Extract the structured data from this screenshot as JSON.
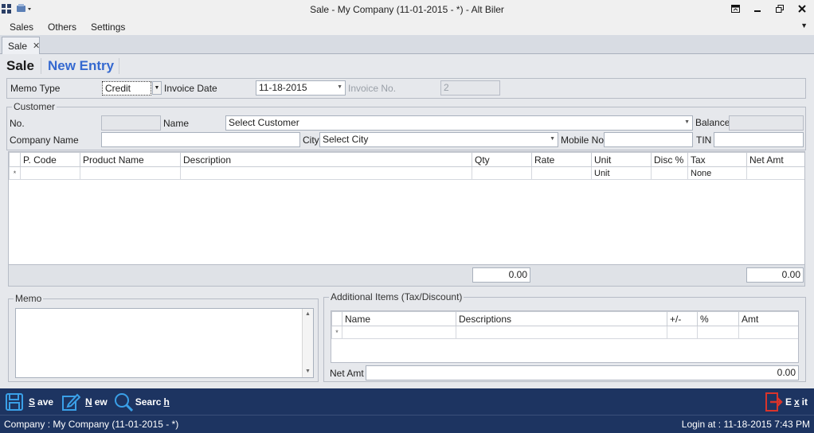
{
  "window": {
    "title": "Sale - My Company (11-01-2015 - *) - Alt Biler"
  },
  "menu": {
    "items": [
      "Sales",
      "Others",
      "Settings"
    ]
  },
  "tab": {
    "label": "Sale"
  },
  "heading": {
    "title": "Sale",
    "mode": "New Entry"
  },
  "memo_type": {
    "label": "Memo Type",
    "value": "Credit"
  },
  "invoice_date": {
    "label": "Invoice Date",
    "value": "11-18-2015"
  },
  "invoice_no": {
    "label": "Invoice No.",
    "value": "2"
  },
  "customer": {
    "legend": "Customer",
    "no_label": "No.",
    "no_value": "",
    "name_label": "Name",
    "name_value": "Select Customer",
    "balance_label": "Balance",
    "balance_value": "",
    "company_label": "Company Name",
    "company_value": "",
    "city_label": "City",
    "city_value": "Select City",
    "mobile_label": "Mobile No.",
    "mobile_value": "",
    "tin_label": "TIN",
    "tin_value": ""
  },
  "product_grid": {
    "columns": [
      "P. Code",
      "Product Name",
      "Description",
      "Qty",
      "Rate",
      "Unit",
      "Disc %",
      "Tax",
      "Net Amt"
    ],
    "new_row": {
      "marker": "*",
      "unit": "Unit",
      "tax": "None"
    },
    "total_qty": "0.00",
    "total_net_amt": "0.00"
  },
  "memo": {
    "legend": "Memo",
    "value": ""
  },
  "additional": {
    "legend": "Additional Items (Tax/Discount)",
    "columns": [
      "Name",
      "Descriptions",
      "+/-",
      "%",
      "Amt"
    ],
    "new_row_marker": "*",
    "net_amt_label": "Net Amt",
    "net_amt_value": "0.00"
  },
  "footer": {
    "save": {
      "pre": "",
      "u": "S",
      "post": "ave"
    },
    "new": {
      "pre": "",
      "u": "N",
      "post": "ew"
    },
    "search": {
      "pre": "Searc",
      "u": "h",
      "post": ""
    },
    "exit": {
      "pre": "E",
      "u": "x",
      "post": "it"
    }
  },
  "status": {
    "company": "Company : My Company  (11-01-2015 - *)",
    "login": "Login at : 11-18-2015 7:43 PM"
  },
  "colors": {
    "accent": "#3569d0",
    "footer_bg": "#1d3461",
    "icon_blue": "#3aa0e8",
    "exit_red": "#d9342b"
  }
}
